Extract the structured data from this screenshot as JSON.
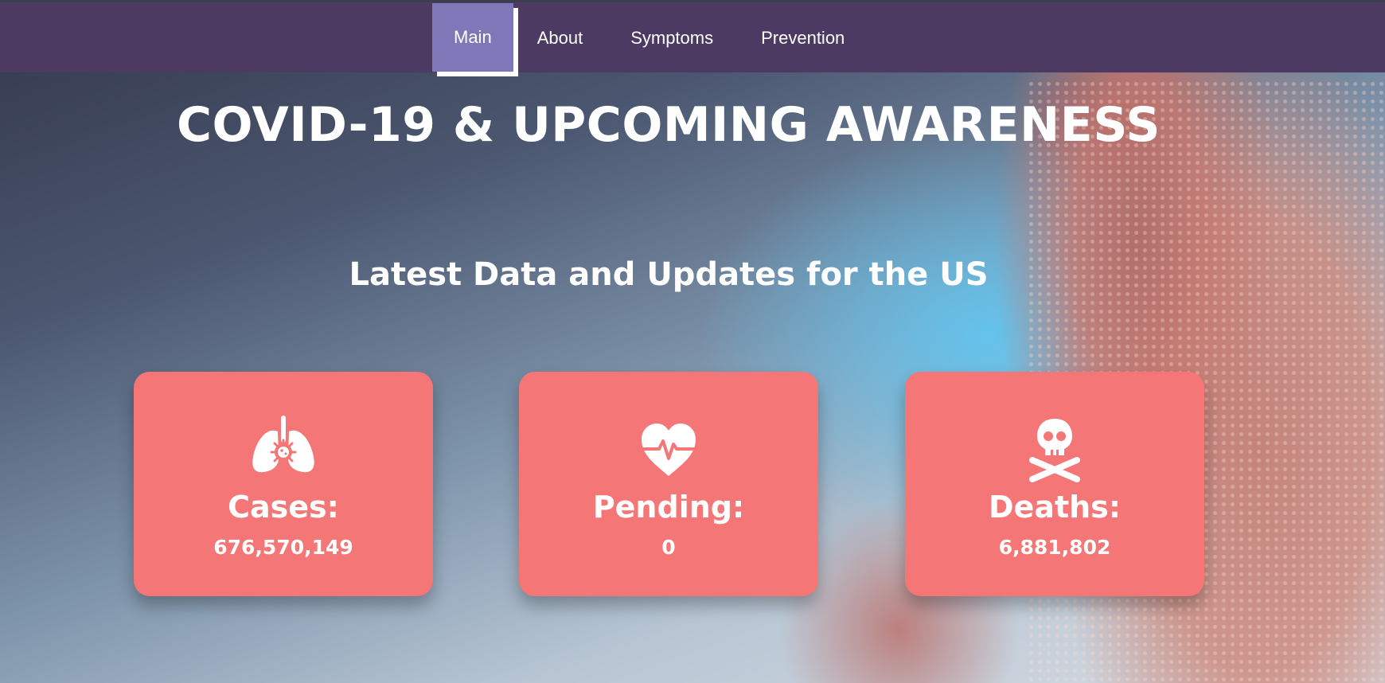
{
  "nav": {
    "items": [
      {
        "label": "Main",
        "active": true
      },
      {
        "label": "About",
        "active": false
      },
      {
        "label": "Symptoms",
        "active": false
      },
      {
        "label": "Prevention",
        "active": false
      }
    ]
  },
  "hero": {
    "title": "COVID-19 & UPCOMING AWARENESS",
    "subtitle": "Latest Data and Updates for the US"
  },
  "stats": [
    {
      "icon": "lungs-virus-icon",
      "label": "Cases:",
      "value": "676,570,149"
    },
    {
      "icon": "heartbeat-icon",
      "label": "Pending:",
      "value": "0"
    },
    {
      "icon": "skull-crossbones-icon",
      "label": "Deaths:",
      "value": "6,881,802"
    }
  ],
  "colors": {
    "nav_bg": "#4d3a63",
    "nav_active": "#7f78b8",
    "card_bg": "#f47676",
    "text": "#ffffff"
  }
}
